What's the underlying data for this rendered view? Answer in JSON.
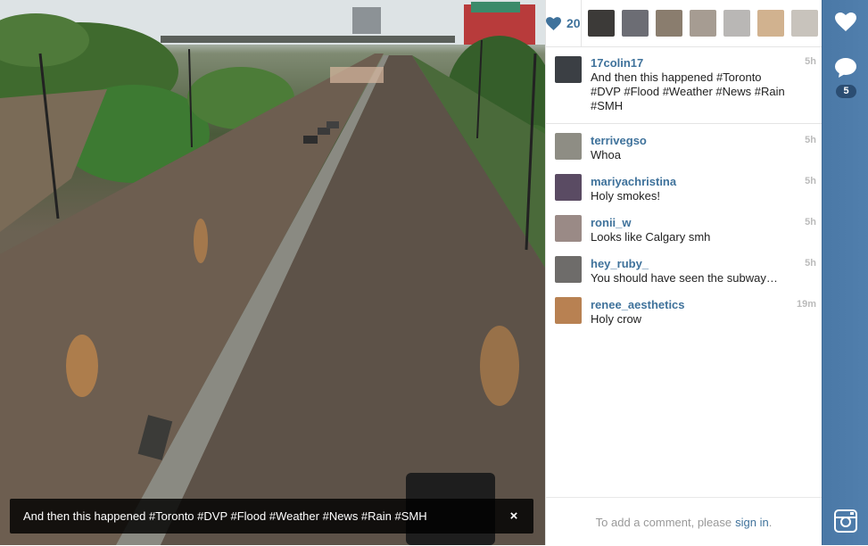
{
  "photo": {
    "caption": "And then this happened #Toronto #DVP #Flood #Weather #News #Rain #SMH",
    "close_label": "×"
  },
  "likes": {
    "count": "20",
    "liker_colors": [
      "#3c3a38",
      "#6c6d74",
      "#8a7d6e",
      "#a69c92",
      "#b9b7b5",
      "#d1b28f",
      "#c8c3bc"
    ]
  },
  "post": {
    "username": "17colin17",
    "text": "And then this happened #Toronto #DVP #Flood #Weather #News #Rain #SMH",
    "time": "5h"
  },
  "comments": [
    {
      "username": "terrivegso",
      "text": "Whoa",
      "time": "5h",
      "avatar_color": "#8e8d84"
    },
    {
      "username": "mariyachristina",
      "text": "Holy smokes!",
      "time": "5h",
      "avatar_color": "#5a4b63"
    },
    {
      "username": "ronii_w",
      "text": "Looks like Calgary smh",
      "time": "5h",
      "avatar_color": "#9a8a86"
    },
    {
      "username": "hey_ruby_",
      "text": "You should have seen the subway…",
      "time": "5h",
      "avatar_color": "#6e6c6a"
    },
    {
      "username": "renee_aesthetics",
      "text": "Holy crow",
      "time": "19m",
      "avatar_color": "#b88152"
    }
  ],
  "footer": {
    "prompt": "To add a comment, please",
    "link": "sign in",
    "period": "."
  },
  "sidebar": {
    "comment_count": "5"
  },
  "colors": {
    "accent": "#3f729b",
    "sidebar": "#517fad"
  }
}
